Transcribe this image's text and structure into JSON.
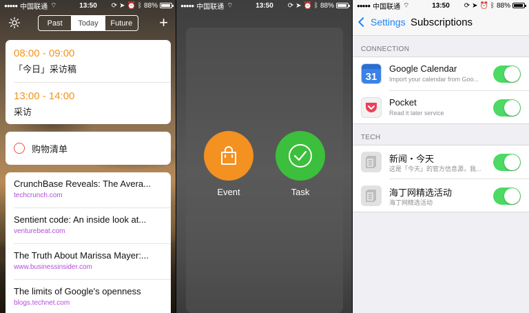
{
  "status": {
    "carrier": "中国联通",
    "time": "13:50",
    "battery": "88%"
  },
  "screen1": {
    "segments": [
      "Past",
      "Today",
      "Future"
    ],
    "active_segment": "Today",
    "events": [
      {
        "time": "08:00 - 09:00",
        "title": "「今日」采访稿"
      },
      {
        "time": "13:00 - 14:00",
        "title": "采访"
      }
    ],
    "todo": "购物清单",
    "news": [
      {
        "headline": "CrunchBase Reveals: The Avera...",
        "domain": "techcrunch.com"
      },
      {
        "headline": "Sentient code: An inside look at...",
        "domain": "venturebeat.com"
      },
      {
        "headline": "The Truth About Marissa Mayer:...",
        "domain": "www.businessinsider.com"
      },
      {
        "headline": "The limits of Google's openness",
        "domain": "blogs.technet.com"
      }
    ]
  },
  "screen2": {
    "actions": [
      {
        "label": "Event"
      },
      {
        "label": "Task"
      }
    ]
  },
  "screen3": {
    "back_label": "Settings",
    "title": "Subscriptions",
    "sections": [
      {
        "header": "CONNECTION",
        "rows": [
          {
            "name": "Google Calendar",
            "subtitle": "Import your calendar from Goo...",
            "icon_text": "31",
            "enabled": true
          },
          {
            "name": "Pocket",
            "subtitle": "Read it later service",
            "enabled": true
          }
        ]
      },
      {
        "header": "TECH",
        "rows": [
          {
            "name": "新闻・今天",
            "subtitle": "这是「今天」的官方信息源，我...",
            "enabled": true
          },
          {
            "name": "海丁网精选活动",
            "subtitle": "海丁网精选活动",
            "enabled": true
          }
        ]
      }
    ]
  },
  "colors": {
    "accent_orange": "#f39121",
    "accent_green": "#3cbf3c",
    "ios_blue": "#1a84f5",
    "toggle_on": "#4cd964",
    "news_domain": "#b04dd8"
  }
}
